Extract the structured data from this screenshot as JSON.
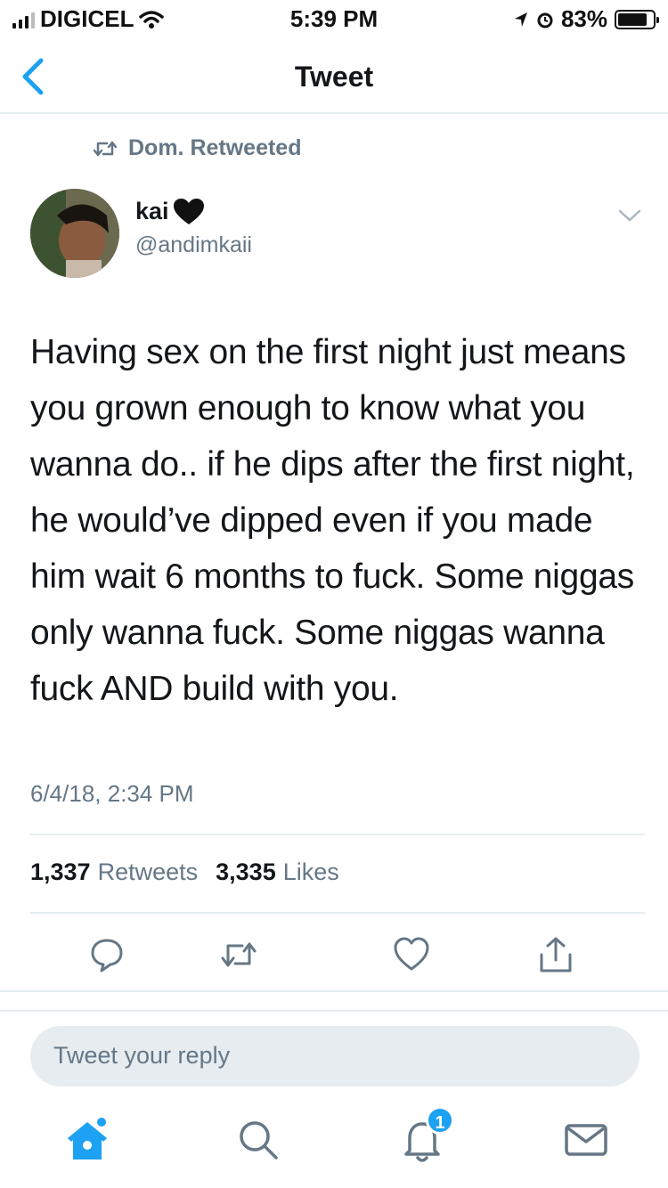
{
  "status_bar": {
    "carrier": "DIGICEL",
    "time": "5:39 PM",
    "battery": "83%",
    "battery_level": 0.83
  },
  "nav": {
    "title": "Tweet"
  },
  "retweet_context": "Dom. Retweeted",
  "author": {
    "name": "kai",
    "handle": "@andimkaii"
  },
  "tweet": {
    "text": "Having sex on the first night just means you grown enough to know what you wanna do.. if he dips after the first night, he would’ve dipped even if you made him wait 6 months to fuck. Some niggas only wanna fuck. Some niggas wanna fuck AND build with you.",
    "timestamp": "6/4/18, 2:34 PM"
  },
  "stats": {
    "retweets_count": "1,337",
    "retweets_label": "Retweets",
    "likes_count": "3,335",
    "likes_label": "Likes"
  },
  "reply": {
    "placeholder": "Tweet your reply"
  },
  "tabbar": {
    "notifications_badge": "1"
  },
  "colors": {
    "accent": "#1da1f2",
    "secondary_text": "#657786",
    "divider": "#e6ecf0"
  },
  "icons": [
    "back-chevron-icon",
    "retweet-icon",
    "heart-icon",
    "caret-down-icon",
    "reply-icon",
    "like-icon",
    "share-icon",
    "home-icon",
    "search-icon",
    "notifications-icon",
    "messages-icon"
  ]
}
